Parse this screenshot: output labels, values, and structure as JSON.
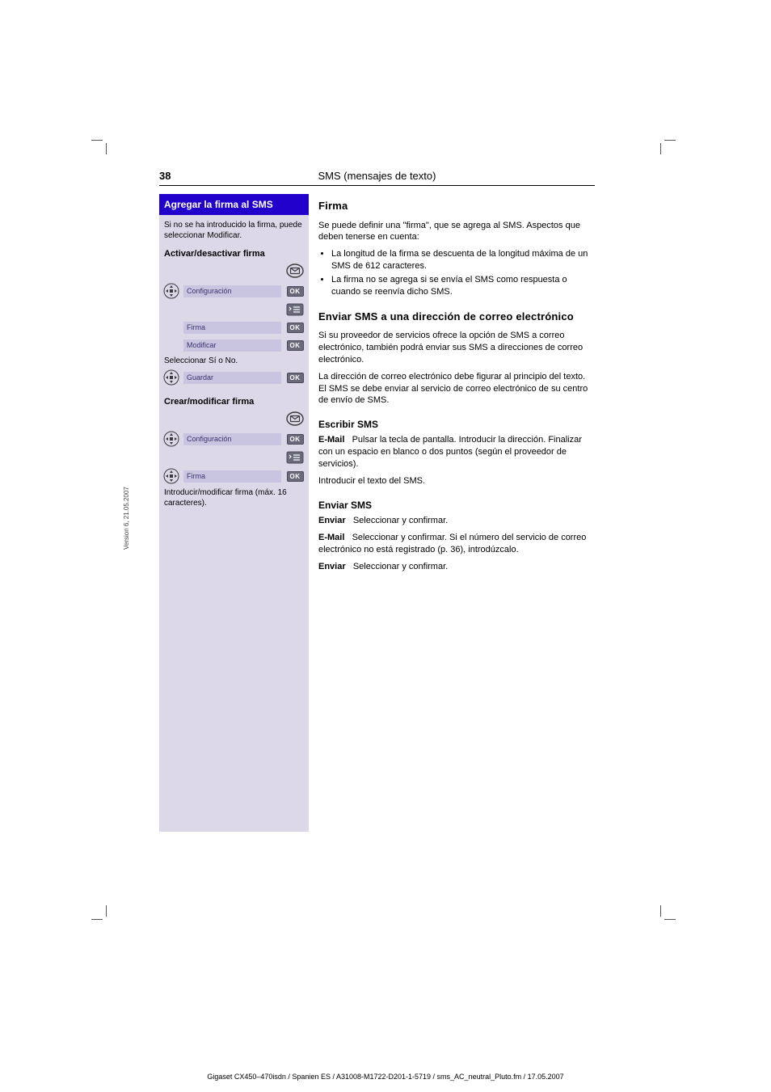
{
  "header": {
    "page_number": "38",
    "title": "SMS (mensajes de texto)"
  },
  "sidebar": {
    "title": "Agregar la firma al SMS",
    "description": "Si no se ha introducido la firma, puede seleccionar Modificar.",
    "sub1": "Activar/desactivar firma",
    "steps1": [
      {
        "left": null,
        "text": "",
        "right": "mail"
      },
      {
        "left": "dpad",
        "text": "Configuración",
        "right": "ok"
      },
      {
        "left": null,
        "text": "",
        "right": "options"
      },
      {
        "left": null,
        "text": "Firma",
        "right": "ok"
      },
      {
        "left": null,
        "text": "Modificar",
        "right": "ok"
      },
      {
        "left": null,
        "text": "Seleccionar Sí o No.",
        "right": null,
        "plain": true
      },
      {
        "left": "dpad",
        "text": "Guardar",
        "right": "ok"
      }
    ],
    "sub2": "Crear/modificar firma",
    "steps2": [
      {
        "left": null,
        "text": "",
        "right": "mail"
      },
      {
        "left": "dpad",
        "text": "Configuración",
        "right": "ok"
      },
      {
        "left": null,
        "text": "",
        "right": "options"
      },
      {
        "left": "dpad",
        "text": "Firma",
        "right": "ok"
      },
      {
        "left": null,
        "text": "Introducir/modificar firma (máx. 16 caracteres).",
        "right": null,
        "plain": true
      }
    ]
  },
  "right": {
    "firma": {
      "title": "Firma",
      "p1": "Se puede definir una \"firma\", que se agrega al SMS. Aspectos que deben tenerse en cuenta:",
      "bullets": [
        "La longitud de la firma se descuenta de la longitud máxima de un SMS de 612 caracteres.",
        "La firma no se agrega si se envía el SMS como respuesta o cuando se reenvía dicho SMS."
      ]
    },
    "smtp": {
      "title": "Enviar SMS a una dirección de correo electrónico",
      "p1": "Si su proveedor de servicios ofrece la opción de SMS a correo electrónico, también podrá enviar sus SMS a direcciones de correo electrónico.",
      "p2": "La dirección de correo electrónico debe figurar al principio del texto. El SMS se debe enviar al servicio de correo electrónico de su centro de envío de SMS.",
      "escribir_title": "Escribir SMS",
      "boton1": "E-Mail",
      "boton1_desc": "Pulsar la tecla de pantalla. Introducir la dirección. Finalizar con un espacio en blanco o dos puntos (según el proveedor de servicios).",
      "step_text": "Introducir el texto del SMS.",
      "enviar_title": "Enviar SMS",
      "send_label": "Enviar",
      "send_desc": "Seleccionar y confirmar.",
      "mail_label": "E-Mail",
      "mail_desc": "Seleccionar y confirmar. Si el número del servicio de correo electrónico no está registrado (p. 36), introdúzcalo.",
      "send2_label": "Enviar",
      "send2_desc": "Seleccionar y confirmar."
    }
  },
  "footer": "Gigaset CX450–470isdn / Spanien ES / A31008-M1722-D201-1-5719 / sms_AC_neutral_Pluto.fm / 17.05.2007",
  "side_label": "Version 6, 21.05.2007"
}
